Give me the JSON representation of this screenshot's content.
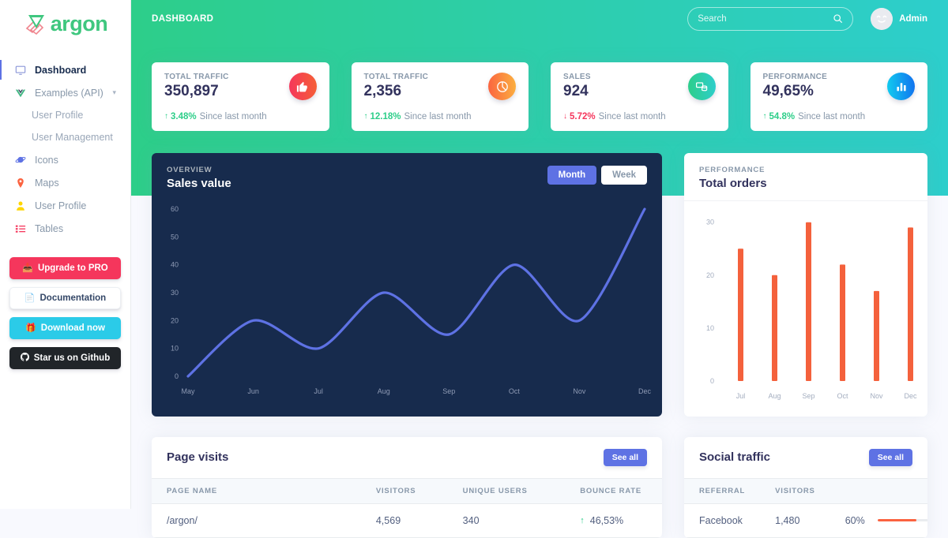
{
  "brand": {
    "name": "argon",
    "logo_icon": "argon-v-logo",
    "accent": "#3fc77f"
  },
  "sidebar": {
    "items": [
      {
        "label": "Dashboard",
        "icon": "desktop-icon",
        "active": true
      },
      {
        "label": "Examples (API)",
        "icon": "vue-icon",
        "active": false,
        "caret": "chevron-down-icon"
      },
      {
        "label": "User Profile",
        "icon": "none",
        "sub": true
      },
      {
        "label": "User Management",
        "icon": "none",
        "sub": true
      },
      {
        "label": "Icons",
        "icon": "planet-icon",
        "active": false
      },
      {
        "label": "Maps",
        "icon": "map-pin-icon",
        "active": false
      },
      {
        "label": "User Profile",
        "icon": "person-icon",
        "active": false
      },
      {
        "label": "Tables",
        "icon": "bullet-list-icon",
        "active": false
      }
    ],
    "buttons": [
      {
        "label": "Upgrade to PRO",
        "icon": "download-icon",
        "style": "pro",
        "color": "#f5365c"
      },
      {
        "label": "Documentation",
        "icon": "document-icon",
        "style": "doc",
        "color": "#ffffff"
      },
      {
        "label": "Download now",
        "icon": "gift-icon",
        "style": "download",
        "color": "#2bcbe8"
      },
      {
        "label": "Star us on Github",
        "icon": "github-icon",
        "style": "github",
        "color": "#212529"
      }
    ]
  },
  "topbar": {
    "breadcrumb": "DASHBOARD",
    "search": {
      "placeholder": "Search",
      "value": "",
      "icon": "search-icon"
    },
    "user": {
      "name": "Admin",
      "avatar_icon": "smiley-avatar"
    }
  },
  "stats": [
    {
      "label": "TOTAL TRAFFIC",
      "value": "350,897",
      "delta": "3.48%",
      "direction": "up",
      "note": "Since last month",
      "icon": "thumbs-up-icon",
      "icon_style": "red"
    },
    {
      "label": "TOTAL TRAFFIC",
      "value": "2,356",
      "delta": "12.18%",
      "direction": "up",
      "note": "Since last month",
      "icon": "pie-chart-icon",
      "icon_style": "orange"
    },
    {
      "label": "SALES",
      "value": "924",
      "delta": "5.72%",
      "direction": "down",
      "note": "Since last month",
      "icon": "money-coins-icon",
      "icon_style": "green"
    },
    {
      "label": "PERFORMANCE",
      "value": "49,65%",
      "delta": "54.8%",
      "direction": "up",
      "note": "Since last month",
      "icon": "bar-chart-icon",
      "icon_style": "blue"
    }
  ],
  "sales_card": {
    "pretitle": "OVERVIEW",
    "title": "Sales value",
    "toggle": [
      {
        "label": "Month",
        "active": true
      },
      {
        "label": "Week",
        "active": false
      }
    ]
  },
  "orders_card": {
    "pretitle": "PERFORMANCE",
    "title": "Total orders"
  },
  "page_visits": {
    "title": "Page visits",
    "see_all": "See all",
    "columns": [
      "PAGE NAME",
      "VISITORS",
      "UNIQUE USERS",
      "BOUNCE RATE"
    ],
    "rows": [
      {
        "page": "/argon/",
        "visitors": "4,569",
        "unique": "340",
        "bounce": "46,53%",
        "direction": "up"
      }
    ]
  },
  "social_traffic": {
    "title": "Social traffic",
    "see_all": "See all",
    "columns": [
      "REFERRAL",
      "VISITORS",
      ""
    ],
    "rows": [
      {
        "referral": "Facebook",
        "visitors": "1,480",
        "percent": "60%",
        "percent_value": 60,
        "bar_color": "#fb6340"
      }
    ]
  },
  "chart_data": [
    {
      "type": "line",
      "title": "Sales value",
      "subtitle": "OVERVIEW",
      "categories": [
        "May",
        "Jun",
        "Jul",
        "Aug",
        "Sep",
        "Oct",
        "Nov",
        "Dec"
      ],
      "values": [
        0,
        20,
        10,
        30,
        15,
        40,
        20,
        60
      ],
      "yticks": [
        0,
        10,
        20,
        30,
        40,
        50,
        60
      ],
      "ylim": [
        0,
        60
      ],
      "xlabel": "",
      "ylabel": "",
      "grid": false,
      "legend": "none",
      "series_color": "#5e72e4",
      "background": "#172b4d"
    },
    {
      "type": "bar",
      "title": "Total orders",
      "subtitle": "PERFORMANCE",
      "categories": [
        "Jul",
        "Aug",
        "Sep",
        "Oct",
        "Nov",
        "Dec"
      ],
      "values": [
        25,
        20,
        30,
        22,
        17,
        29
      ],
      "yticks": [
        0,
        10,
        20,
        30
      ],
      "ylim": [
        0,
        31
      ],
      "xlabel": "",
      "ylabel": "",
      "grid": false,
      "legend": "none",
      "series_color": "#f4613c",
      "background": "#ffffff"
    }
  ]
}
